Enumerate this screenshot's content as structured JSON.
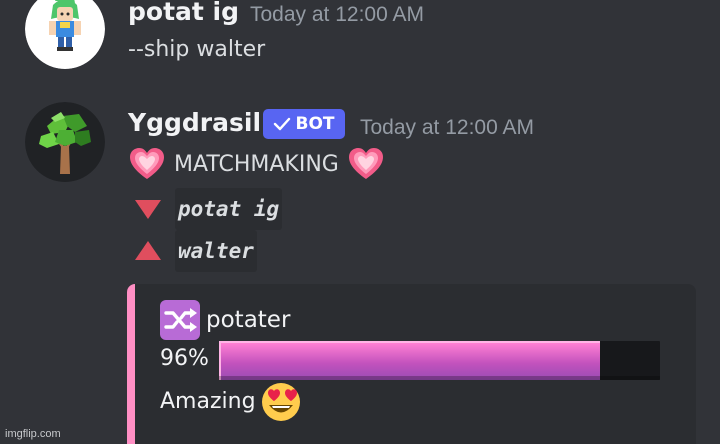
{
  "messages": [
    {
      "author": "potat ig",
      "timestamp": "Today at 12:00 AM",
      "text": "--ship walter",
      "avatar_icon": "green-haired-character-avatar"
    },
    {
      "author": "Yggdrasil",
      "bot_tag": "BOT",
      "timestamp": "Today at 12:00 AM",
      "avatar_icon": "tree-avatar",
      "heading": "MATCHMAKING",
      "heading_icon": "heartpulse-icon",
      "lines": [
        {
          "icon": "red-triangle-down-icon",
          "code": "potat ig"
        },
        {
          "icon": "red-triangle-up-icon",
          "code": "walter"
        }
      ],
      "embed": {
        "accent_color": "#ff8fc4",
        "title_icon": "shuffle-icon",
        "title": "potater",
        "percent_label": "96%",
        "progress": 0.96,
        "verdict": "Amazing",
        "verdict_icon": "heart-eyes-emoji"
      }
    }
  ],
  "watermark": "imgflip.com"
}
